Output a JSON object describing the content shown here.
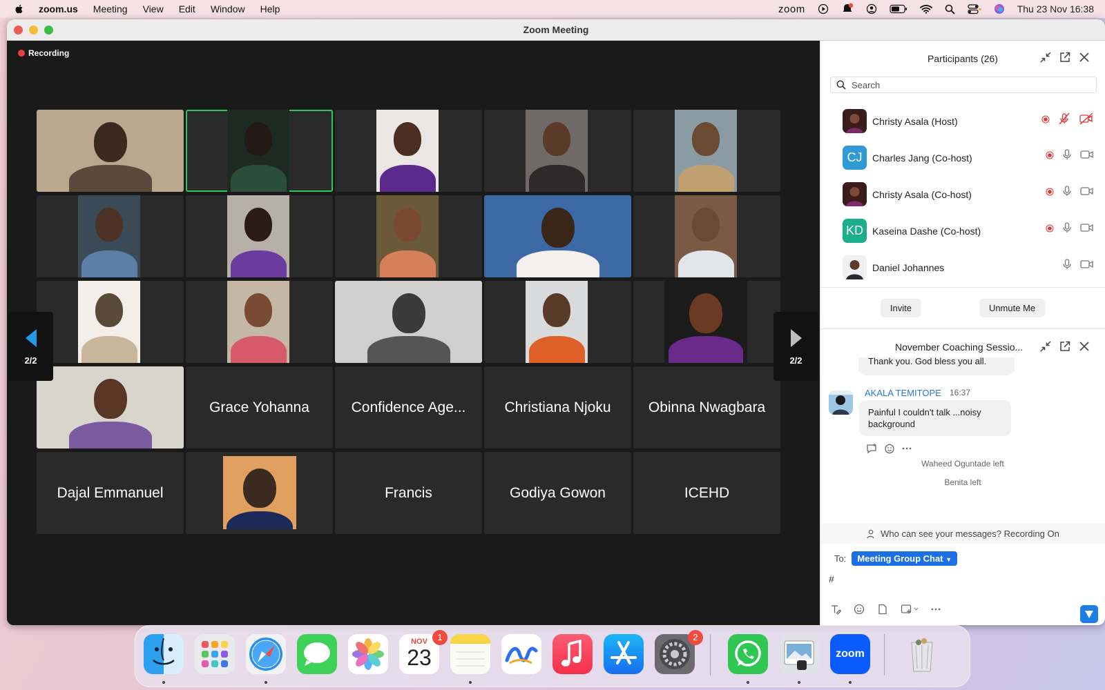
{
  "menubar": {
    "app_name": "zoom.us",
    "items": [
      "Meeting",
      "View",
      "Edit",
      "Window",
      "Help"
    ],
    "status_app": "zoom",
    "datetime": "Thu 23 Nov  16:38"
  },
  "window": {
    "title": "Zoom Meeting",
    "recording_label": "Recording"
  },
  "gallery": {
    "page_indicator_left": "2/2",
    "page_indicator_right": "2/2",
    "tiles": [
      {
        "type": "video",
        "palette": [
          "#b9a78e",
          "#3b2a20",
          "#5b4a3c"
        ]
      },
      {
        "type": "video",
        "palette": [
          "#1d2a24",
          "#241a15",
          "#2c4d3a"
        ],
        "active": true
      },
      {
        "type": "video",
        "palette": [
          "#e9e6e4",
          "#4a2f22",
          "#5b2a8c"
        ]
      },
      {
        "type": "video",
        "palette": [
          "#6f6a68",
          "#5a3a28",
          "#2c2a2a"
        ]
      },
      {
        "type": "video",
        "palette": [
          "#8a9ba3",
          "#6b4a33",
          "#c0a070"
        ]
      },
      {
        "type": "video",
        "palette": [
          "#3a4b57",
          "#4c3224",
          "#5b7fa6"
        ]
      },
      {
        "type": "video",
        "palette": [
          "#b7b0a8",
          "#2c1c17",
          "#6a3ca0"
        ]
      },
      {
        "type": "video",
        "palette": [
          "#6a5a3a",
          "#7a4a30",
          "#d6805a"
        ]
      },
      {
        "type": "video",
        "palette": [
          "#3d6aa6",
          "#3a2519",
          "#f3f1ee"
        ]
      },
      {
        "type": "video",
        "palette": [
          "#7a5a44",
          "#6b4a33",
          "#e2e5ea"
        ]
      },
      {
        "type": "video",
        "palette": [
          "#f3efe8",
          "#5a4a38",
          "#c9b59a"
        ]
      },
      {
        "type": "video",
        "palette": [
          "#c4b7a6",
          "#7a4a33",
          "#d65a6a"
        ]
      },
      {
        "type": "video",
        "palette": [
          "#cfcfcf",
          "#3a3a3a",
          "#555555"
        ]
      },
      {
        "type": "video",
        "palette": [
          "#d8dadc",
          "#5a3a28",
          "#e0602a"
        ]
      },
      {
        "type": "video",
        "palette": [
          "#1c1c1c",
          "#6a3a22",
          "#6a2a8a"
        ]
      },
      {
        "type": "video",
        "palette": [
          "#d8d5cc",
          "#5a3626",
          "#7c5a9e"
        ]
      },
      {
        "type": "name",
        "name": "Grace Yohanna"
      },
      {
        "type": "name",
        "name": "Confidence Age..."
      },
      {
        "type": "name",
        "name": "Christiana Njoku"
      },
      {
        "type": "name",
        "name": "Obinna Nwagbara"
      },
      {
        "type": "name",
        "name": "Dajal Emmanuel"
      },
      {
        "type": "video",
        "palette": [
          "#e2a060",
          "#3a2a20",
          "#1c2a5a"
        ]
      },
      {
        "type": "name",
        "name": "Francis"
      },
      {
        "type": "name",
        "name": "Godiya Gowon"
      },
      {
        "type": "name",
        "name": "ICEHD"
      }
    ]
  },
  "participants": {
    "title": "Participants (26)",
    "search_placeholder": "Search",
    "list": [
      {
        "name": "Christy Asala (Host)",
        "avatar": "photo",
        "recording": true,
        "muted": true,
        "video_off": true
      },
      {
        "name": "Charles Jang (Co-host)",
        "avatar": "CJ",
        "avatar_color": "#2f9ad6",
        "recording": true
      },
      {
        "name": "Christy Asala (Co-host)",
        "avatar": "photo",
        "recording": true
      },
      {
        "name": "Kaseina Dashe (Co-host)",
        "avatar": "KD",
        "avatar_color": "#1aae8a",
        "recording": true
      },
      {
        "name": "Daniel Johannes",
        "avatar": "photo",
        "recording": false
      }
    ],
    "invite_label": "Invite",
    "unmute_label": "Unmute Me"
  },
  "chat": {
    "title": "November Coaching Sessio...",
    "prev_message": "Thank you. God bless you all.",
    "message": {
      "sender": "AKALA TEMITOPE",
      "time": "16:37",
      "text": "Painful I couldn't talk ...noisy background"
    },
    "system": [
      "Waheed Oguntade left",
      "Benita left"
    ],
    "privacy_note": "Who can see your messages? Recording On",
    "to_label": "To:",
    "recipient": "Meeting Group Chat",
    "draft": "#"
  },
  "dock": {
    "calendar_month": "NOV",
    "calendar_day": "23",
    "calendar_badge": "1",
    "settings_badge": "2",
    "zoom_label": "zoom"
  }
}
